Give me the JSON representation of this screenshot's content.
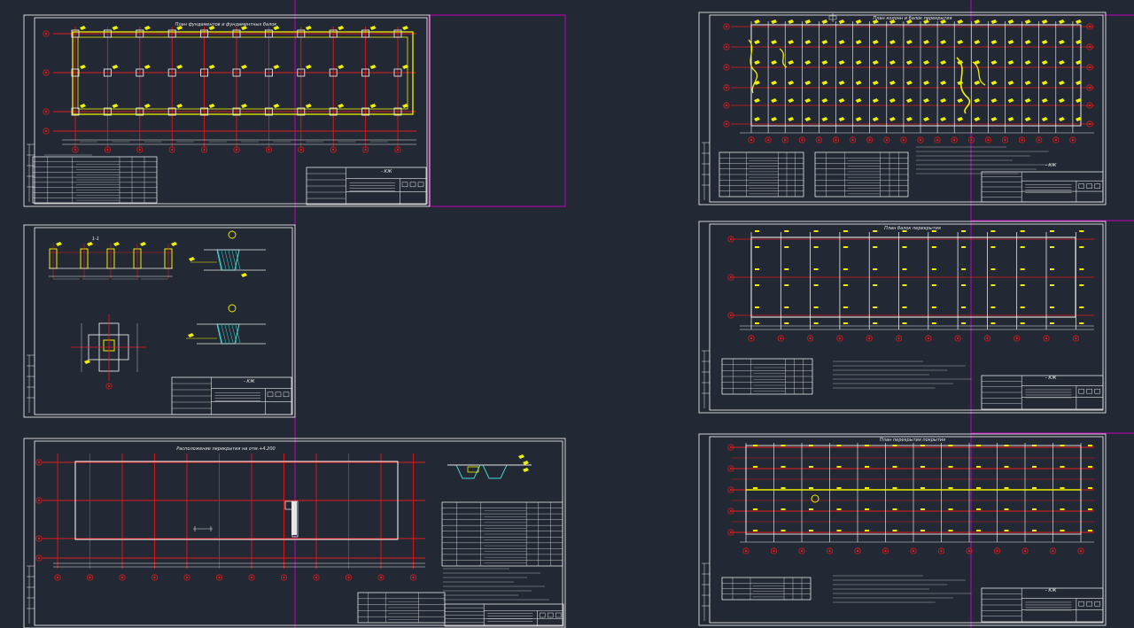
{
  "viewport": {
    "background": "#222834"
  },
  "colors": {
    "frame": "#e6e6e6",
    "axis": "#e01b1b",
    "grid_white": "#ffffff",
    "element_yellow": "#f0f000",
    "cyan": "#41e0d8",
    "magenta_viewport": "#c000c0",
    "axis_bubble": "#e01b1b"
  },
  "sheets": [
    {
      "id": "foundation-plan",
      "title": "План фундаментов и фундаментных балок",
      "stamp": "- КЖ"
    },
    {
      "id": "foundation-details",
      "title": "1-1",
      "stamp": "- КЖ"
    },
    {
      "id": "floor-plan",
      "title": "Расположение перекрытия на отм.+4.200",
      "stamp": ""
    },
    {
      "id": "column-plan",
      "title": "План колонн и балок перекрытия",
      "stamp": "- КЖ"
    },
    {
      "id": "beam-plan",
      "title": "План балок перекрытия",
      "stamp": "- КЖ"
    },
    {
      "id": "slab-plan",
      "title": "План перекрытия покрытия",
      "stamp": "- КЖ"
    }
  ],
  "icons": [
    "drawing-sheet-icon"
  ]
}
